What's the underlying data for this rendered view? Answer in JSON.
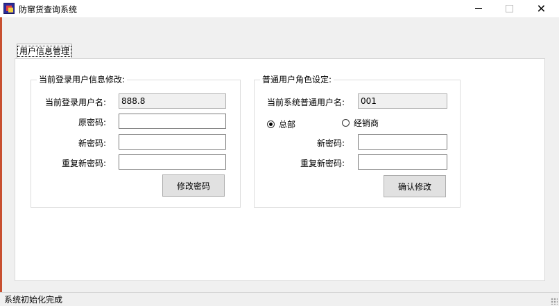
{
  "window": {
    "title": "防窜货查询系统",
    "icon": "app-logo-icon"
  },
  "tab": {
    "label": "用户信息管理"
  },
  "left_group": {
    "title": "当前登录用户信息修改:",
    "username_label": "当前登录用户名:",
    "username_value": "888.8",
    "old_password_label": "原密码:",
    "new_password_label": "新密码:",
    "repeat_password_label": "重复新密码:",
    "submit_label": "修改密码"
  },
  "right_group": {
    "title": "普通用户角色设定:",
    "username_label": "当前系统普通用户名:",
    "username_value": "001",
    "radio_hq": "总部",
    "radio_dealer": "经销商",
    "selected": "总部",
    "new_password_label": "新密码:",
    "repeat_password_label": "重复新密码:",
    "submit_label": "确认修改"
  },
  "status": {
    "text": "系统初始化完成"
  }
}
